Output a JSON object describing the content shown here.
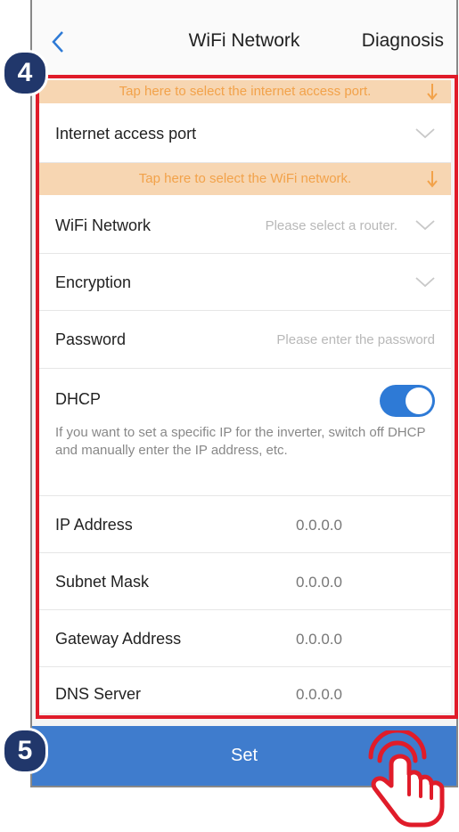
{
  "header": {
    "title": "WiFi Network",
    "right_action": "Diagnosis"
  },
  "banners": {
    "port_hint": "Tap here to select the internet access port.",
    "wifi_hint": "Tap here to select the WiFi network."
  },
  "fields": {
    "internet_port": {
      "label": "Internet access port"
    },
    "wifi_network": {
      "label": "WiFi Network",
      "placeholder": "Please select a router."
    },
    "encryption": {
      "label": "Encryption"
    },
    "password": {
      "label": "Password",
      "placeholder": "Please enter the password"
    },
    "dhcp": {
      "label": "DHCP",
      "enabled": true,
      "description": "If you want to set a specific IP for the inverter, switch off DHCP and manually enter the IP address, etc."
    },
    "ip_address": {
      "label": "IP Address",
      "value": "0.0.0.0"
    },
    "subnet_mask": {
      "label": "Subnet Mask",
      "value": "0.0.0.0"
    },
    "gateway": {
      "label": "Gateway Address",
      "value": "0.0.0.0"
    },
    "dns": {
      "label": "DNS Server",
      "value": "0.0.0.0"
    }
  },
  "footer": {
    "set_label": "Set"
  },
  "annotations": {
    "step_a": "4",
    "step_b": "5"
  },
  "colors": {
    "accent": "#3f7ccd",
    "toggle_on": "#2e7ad6",
    "banner_bg": "#f7d6b2",
    "banner_text": "#f2a24a",
    "highlight": "#e01c2a",
    "marker": "#21376b"
  },
  "icons": {
    "back": "chevron-left-icon",
    "dropdown": "chevron-down-icon",
    "hint": "arrow-down-icon",
    "pointer": "hand-pointer-icon"
  }
}
